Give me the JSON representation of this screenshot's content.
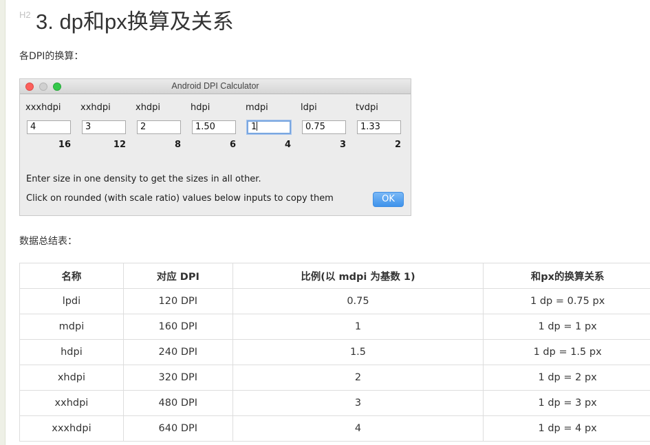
{
  "heading": {
    "badge": "H2",
    "title": "3. dp和px换算及关系"
  },
  "paragraphs": {
    "dpi_conversion": "各DPI的换算：",
    "summary_table": "数据总结表："
  },
  "calculator": {
    "title": "Android DPI Calculator",
    "densities": [
      {
        "label": "xxxhdpi",
        "value": "4",
        "rounded": "16"
      },
      {
        "label": "xxhdpi",
        "value": "3",
        "rounded": "12"
      },
      {
        "label": "xhdpi",
        "value": "2",
        "rounded": "8"
      },
      {
        "label": "hdpi",
        "value": "1.50",
        "rounded": "6"
      },
      {
        "label": "mdpi",
        "value": "1",
        "rounded": "4"
      },
      {
        "label": "ldpi",
        "value": "0.75",
        "rounded": "3"
      },
      {
        "label": "tvdpi",
        "value": "1.33",
        "rounded": "2"
      }
    ],
    "hint1": "Enter size in one density to get the sizes in all other.",
    "hint2": "Click on rounded (with scale ratio) values below inputs to copy them",
    "ok_label": "OK"
  },
  "table": {
    "headers": [
      "名称",
      "对应 DPI",
      "比例(以 mdpi 为基数 1)",
      "和px的换算关系"
    ],
    "rows": [
      [
        "lpdi",
        "120 DPI",
        "0.75",
        "1 dp = 0.75 px"
      ],
      [
        "mdpi",
        "160 DPI",
        "1",
        "1 dp = 1 px"
      ],
      [
        "hdpi",
        "240 DPI",
        "1.5",
        "1 dp = 1.5 px"
      ],
      [
        "xhdpi",
        "320 DPI",
        "2",
        "1 dp = 2 px"
      ],
      [
        "xxhdpi",
        "480 DPI",
        "3",
        "1 dp = 3 px"
      ],
      [
        "xxxhdpi",
        "640 DPI",
        "4",
        "1 dp = 4 px"
      ]
    ]
  }
}
